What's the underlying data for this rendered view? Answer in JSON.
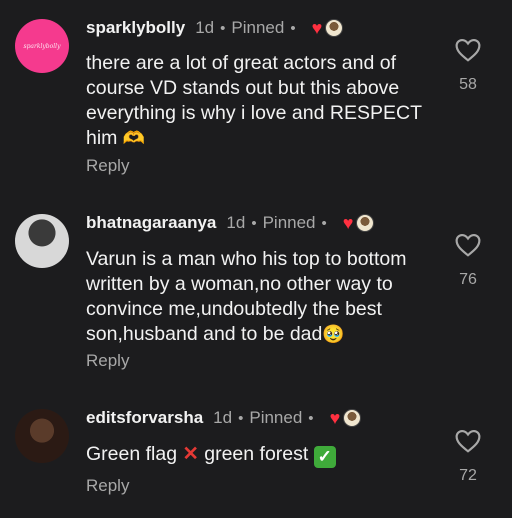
{
  "comments": [
    {
      "username": "sparklybolly",
      "avatar_text": "sparklybolly",
      "time": "1d",
      "pinned": "Pinned",
      "text": "there are a lot of great actors and of course VD stands out but this above everything is why i love and RESPECT him",
      "emoji": "🫶",
      "reply": "Reply",
      "likes": "58"
    },
    {
      "username": "bhatnagaraanya",
      "time": "1d",
      "pinned": "Pinned",
      "text": "Varun is a man who his top to bottom written by a woman,no other way to convince me,undoubtedly the best son,husband and to be dad",
      "emoji": "🥹",
      "reply": "Reply",
      "likes": "76"
    },
    {
      "username": "editsforvarsha",
      "time": "1d",
      "pinned": "Pinned",
      "text_a": "Green flag",
      "mark_a": "✕",
      "text_b": "green forest",
      "mark_b": "✓",
      "reply": "Reply",
      "likes": "72"
    }
  ],
  "icons": {
    "like": "heart-outline-icon",
    "creator_like": "heart-filled-icon"
  },
  "colors": {
    "background": "#1c1c1e",
    "creator_heart": "#ff3040",
    "muted": "#a8a8a8"
  }
}
